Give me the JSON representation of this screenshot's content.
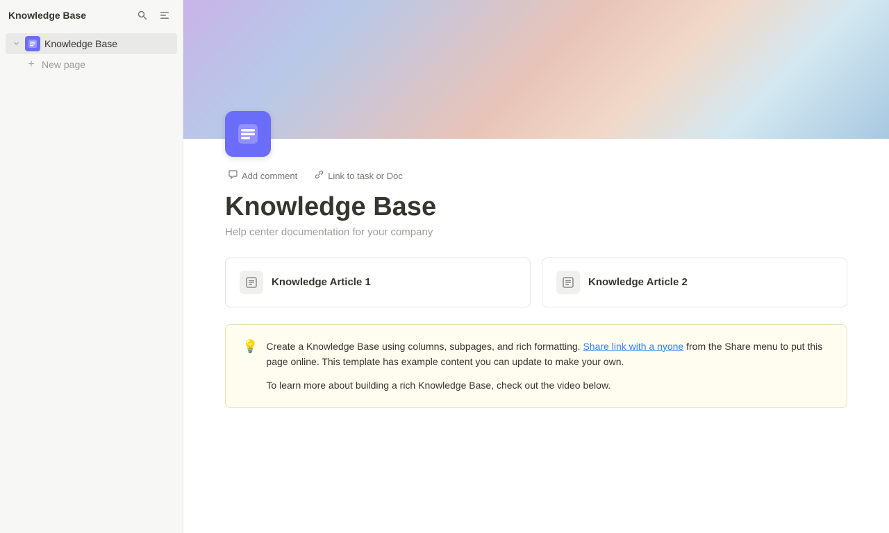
{
  "sidebar": {
    "title": "Knowledge Base",
    "search_icon": "search",
    "collapse_icon": "collapse",
    "nav_items": [
      {
        "id": "knowledge-base",
        "label": "Knowledge Base",
        "icon_color": "#6b6cf8",
        "active": true
      }
    ],
    "new_page_label": "New page"
  },
  "header": {
    "toolbar": {
      "add_comment_label": "Add comment",
      "link_label": "Link to task or Doc"
    }
  },
  "page": {
    "title": "Knowledge Base",
    "subtitle": "Help center documentation for your company",
    "icon_bg": "#6b6cf8"
  },
  "articles": [
    {
      "id": 1,
      "title": "Knowledge Article 1"
    },
    {
      "id": 2,
      "title": "Knowledge Article 2"
    }
  ],
  "info_box": {
    "intro": "Create a Knowledge Base using columns, subpages, and rich formatting. ",
    "link_text": "Share link with a nyone",
    "rest": " from the Share menu to put this page online. This template has example content you can update to make your own.",
    "second_para": "To learn more about building a rich Knowledge Base, check out the video below."
  }
}
